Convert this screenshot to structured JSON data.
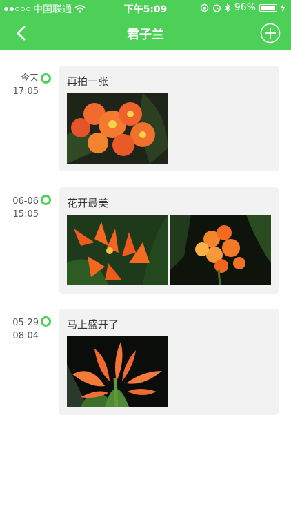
{
  "status_bar": {
    "carrier": "中国联通",
    "time": "下午5:09",
    "battery": "96%",
    "battery_level": 0.96
  },
  "nav": {
    "title": "君子兰"
  },
  "entries": [
    {
      "date": "今天",
      "time": "17:05",
      "caption": "再拍一张",
      "photos": [
        "clivia-photo"
      ]
    },
    {
      "date": "06-06",
      "time": "15:05",
      "caption": "花开最美",
      "photos": [
        "clivia-photo",
        "clivia-photo"
      ]
    },
    {
      "date": "05-29",
      "time": "08:04",
      "caption": "马上盛开了",
      "photos": [
        "clivia-photo"
      ]
    }
  ],
  "colors": {
    "accent": "#4cd058",
    "card": "#f2f2f2",
    "line": "#d0d0d0",
    "text": "#333333"
  }
}
